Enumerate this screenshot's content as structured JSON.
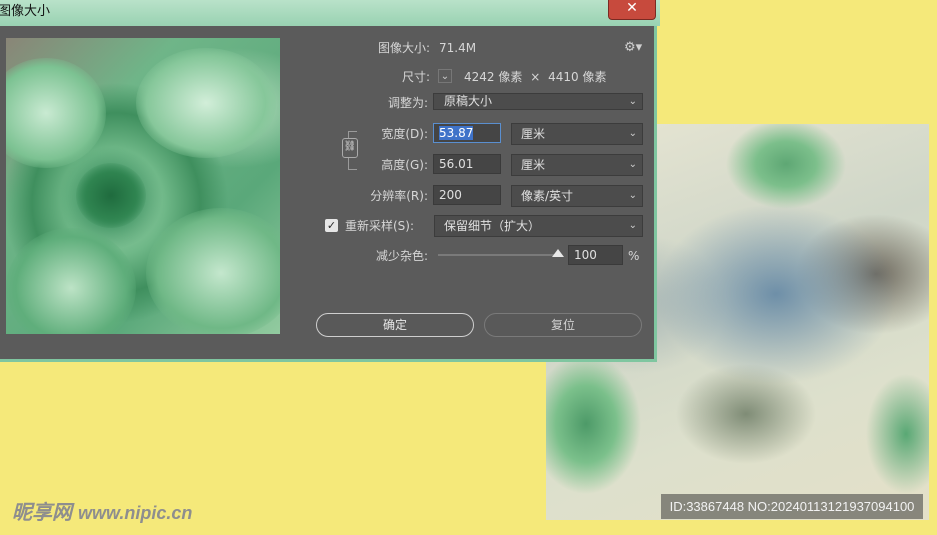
{
  "dialog": {
    "title": "图像大小",
    "image_size_label": "图像大小:",
    "image_size_value": "71.4M",
    "dimensions_label": "尺寸:",
    "dim_width": "4242",
    "dim_unit_1": "像素",
    "dim_x": "×",
    "dim_height": "4410",
    "dim_unit_2": "像素",
    "fit_to_label": "调整为:",
    "fit_to_value": "原稿大小",
    "width_label": "宽度(D):",
    "width_value": "53.87",
    "width_unit": "厘米",
    "height_label": "高度(G):",
    "height_value": "56.01",
    "height_unit": "厘米",
    "resolution_label": "分辨率(R):",
    "resolution_value": "200",
    "resolution_unit": "像素/英寸",
    "resample_label": "重新采样(S):",
    "resample_checked": true,
    "resample_value": "保留细节（扩大）",
    "noise_label": "减少杂色:",
    "noise_value": "100",
    "noise_unit": "%",
    "noise_level": 1.0,
    "ok_label": "确定",
    "reset_label": "复位",
    "close_glyph": "✕",
    "gear_glyph": "⚙▾"
  },
  "page": {
    "watermark": "ID:33867448 NO:20240113121937094100",
    "logo_main": "昵享网",
    "logo_sub": "www.nipic.cn"
  },
  "colors": {
    "page_bg": "#f5e97a",
    "dialog_bg": "#5b5b5b",
    "titlebar": "#a8d9bc",
    "close_button": "#c74a3d",
    "selection": "#3f73c9"
  }
}
